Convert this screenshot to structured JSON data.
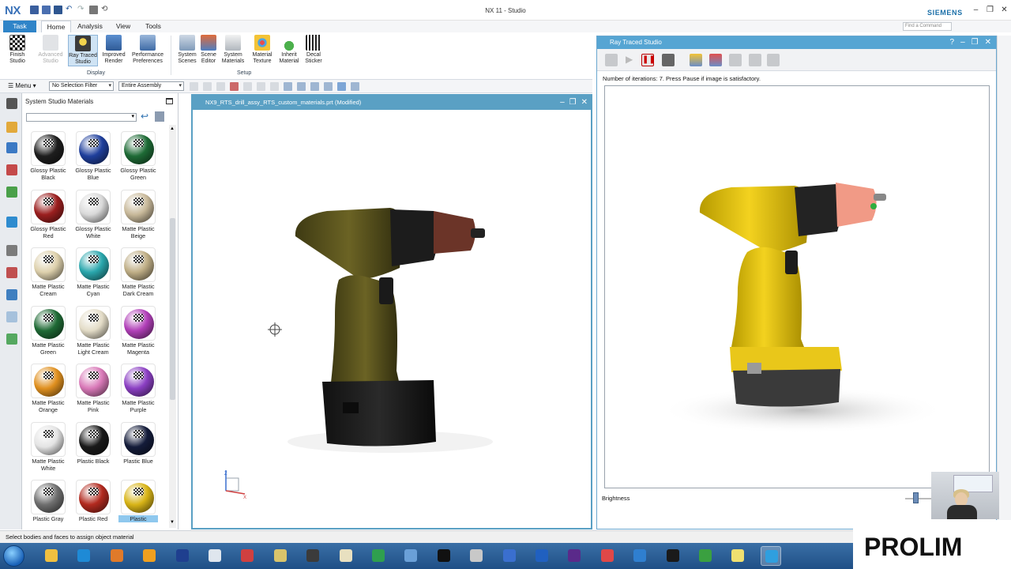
{
  "window": {
    "logo": "NX",
    "title": "NX 11 - Studio",
    "brand": "SIEMENS",
    "search_placeholder": "Find a Command",
    "controls": [
      "–",
      "❐",
      "✕"
    ]
  },
  "ribbon": {
    "tabs": [
      "Task",
      "Home",
      "Analysis",
      "View",
      "Tools"
    ],
    "active_tab": "Home",
    "buttons": [
      {
        "label": "Finish Studio",
        "icon": "checkered-flag-icon"
      },
      {
        "label": "Advanced Studio",
        "icon": "advanced-studio-icon",
        "disabled": true
      },
      {
        "label": "Ray Traced Studio",
        "icon": "ray-traced-studio-icon",
        "active": true
      },
      {
        "label": "Improved Render",
        "icon": "improved-render-icon"
      },
      {
        "label": "Performance Preferences",
        "icon": "performance-icon"
      },
      {
        "label": "System Scenes",
        "icon": "system-scenes-icon"
      },
      {
        "label": "Scene Editor",
        "icon": "scene-editor-icon"
      },
      {
        "label": "System Materials",
        "icon": "system-materials-icon"
      },
      {
        "label": "Material Texture",
        "icon": "material-texture-icon"
      },
      {
        "label": "Inherit Material",
        "icon": "inherit-material-icon"
      },
      {
        "label": "Decal Sticker",
        "icon": "decal-sticker-icon"
      }
    ],
    "groups": [
      "Display",
      "Setup"
    ]
  },
  "selection_bar": {
    "menu_label": "Menu",
    "filter": "No Selection Filter",
    "scope": "Entire Assembly"
  },
  "materials_panel": {
    "title": "System Studio Materials",
    "materials": [
      {
        "name": "Glossy Plastic Black",
        "color": "#1e1e1e"
      },
      {
        "name": "Glossy Plastic Blue",
        "color": "#1f3f9c"
      },
      {
        "name": "Glossy Plastic Green",
        "color": "#1e6b36"
      },
      {
        "name": "Glossy Plastic Red",
        "color": "#9b1f1f"
      },
      {
        "name": "Glossy Plastic White",
        "color": "#d9d9d9"
      },
      {
        "name": "Matte Plastic Beige",
        "color": "#c8b99a"
      },
      {
        "name": "Matte Plastic Cream",
        "color": "#ddd0ac"
      },
      {
        "name": "Matte Plastic Cyan",
        "color": "#2aa7ad"
      },
      {
        "name": "Matte Plastic Dark Cream",
        "color": "#bfae86"
      },
      {
        "name": "Matte Plastic Green",
        "color": "#1f6a35"
      },
      {
        "name": "Matte Plastic Light Cream",
        "color": "#e3dcc7"
      },
      {
        "name": "Matte Plastic Magenta",
        "color": "#b13fb8"
      },
      {
        "name": "Matte Plastic Orange",
        "color": "#e0901f"
      },
      {
        "name": "Matte Plastic Pink",
        "color": "#d979b8"
      },
      {
        "name": "Matte Plastic Purple",
        "color": "#8b3fc3"
      },
      {
        "name": "Matte Plastic White",
        "color": "#e4e4e4"
      },
      {
        "name": "Plastic Black",
        "color": "#1a1a1a"
      },
      {
        "name": "Plastic Blue",
        "color": "#141c3a"
      },
      {
        "name": "Plastic Gray",
        "color": "#6f6f6f"
      },
      {
        "name": "Plastic Red",
        "color": "#b22a1f"
      },
      {
        "name": "Plastic",
        "color": "#d8b417",
        "selected": true
      }
    ]
  },
  "graphics_window": {
    "title": "NX9_RTS_drill_assy_RTS_custom_materials.prt (Modified)",
    "controls": [
      "–",
      "❐",
      "✕"
    ],
    "axis_labels": [
      "Z",
      "X"
    ]
  },
  "ray_traced_studio": {
    "title": "Ray Traced Studio",
    "controls": [
      "?",
      "–",
      "❐",
      "✕"
    ],
    "message": "Number of iterations: 7.  Press Pause if image is satisfactory.",
    "brightness_label": "Brightness",
    "brightness": 0.09
  },
  "status_bar": {
    "text": "Select bodies and faces to assign object material"
  },
  "branding": {
    "logo": "PROLIM"
  },
  "taskbar": {
    "icons": [
      "start-icon",
      "explorer-icon",
      "internet-explorer-icon",
      "media-player-icon",
      "outlook-icon",
      "photoshop-icon",
      "calculator-icon",
      "truck-icon",
      "notes-icon",
      "nx-icon",
      "paint-icon",
      "nx-drill-icon",
      "teamcenter-icon",
      "iq-icon",
      "tools-icon",
      "infinity-icon",
      "pdf-icon",
      "sheets-icon",
      "client-icon",
      "nx-drill-icon-2",
      "x-icon",
      "chart-icon",
      "folder-icon",
      "nx-active-icon"
    ]
  }
}
